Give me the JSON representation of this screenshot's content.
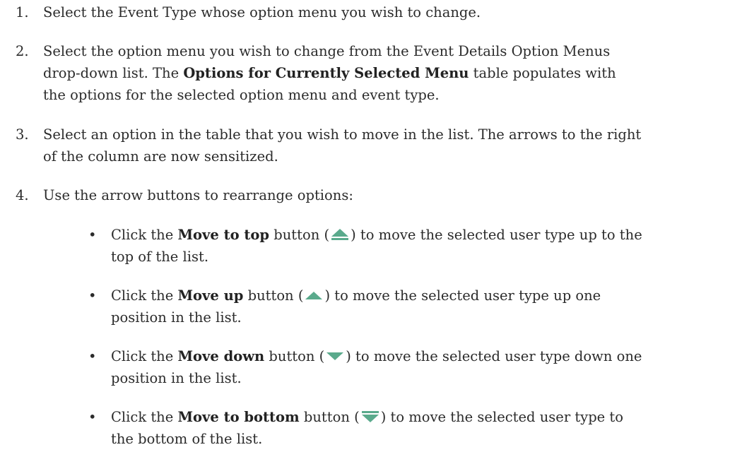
{
  "steps": [
    {
      "number": "1.",
      "lines": [
        "Select the Event Type whose option menu you wish to change."
      ]
    },
    {
      "number": "2.",
      "line1": "Select the option menu you wish to change from the Event Details Option Menus",
      "line2_pre": "drop-down list. The ",
      "line2_bold": "Options for Currently Selected Menu",
      "line2_post": " table populates with",
      "line3": "the options for the selected option menu and event type."
    },
    {
      "number": "3.",
      "line1": "Select an option in the table that you wish to move in the list. The arrows to the right",
      "line2": "of the column are now sensitized."
    },
    {
      "number": "4.",
      "line1": "Use the arrow buttons to rearrange options:"
    }
  ],
  "bullets": [
    {
      "dot": "•",
      "pre": "Click the ",
      "bold": "Move to top",
      "mid": " button (",
      "icon": "move-to-top-icon",
      "post": ") to move the selected user type up to the",
      "line2": "top of the list."
    },
    {
      "dot": "•",
      "pre": "Click the ",
      "bold": "Move up",
      "mid": " button (",
      "icon": "move-up-icon",
      "post": ") to move the selected user type up one",
      "line2": "position in the list."
    },
    {
      "dot": "•",
      "pre": "Click the ",
      "bold": "Move down",
      "mid": " button (",
      "icon": "move-down-icon",
      "post": ") to move the selected user type down one",
      "line2": "position in the list."
    },
    {
      "dot": "•",
      "pre": "Click the ",
      "bold": "Move to bottom",
      "mid": " button (",
      "icon": "move-to-bottom-icon",
      "post": ") to move the selected user type to",
      "line2": "the bottom of the list."
    }
  ],
  "colors": {
    "text": "#2b2b2b",
    "icon_green": "#5aaa8c"
  }
}
